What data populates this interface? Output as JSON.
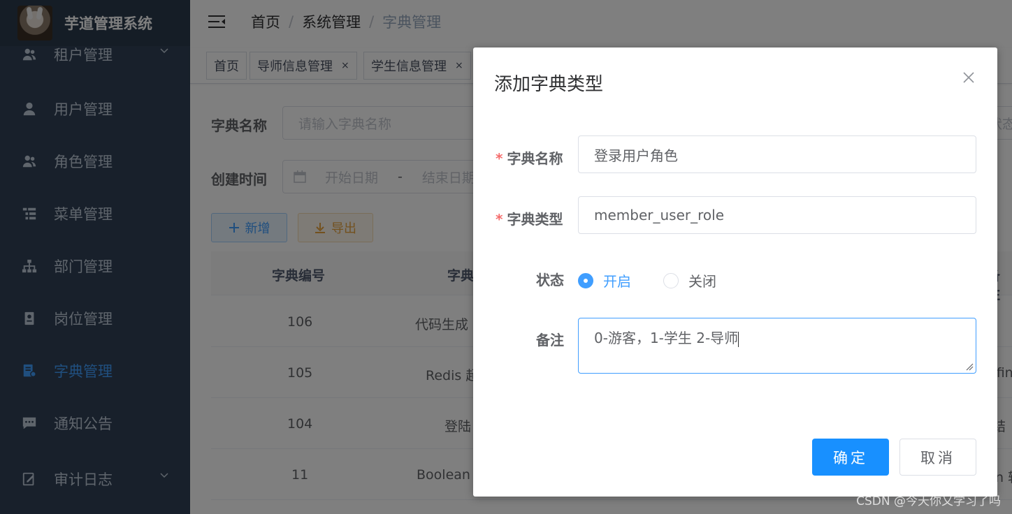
{
  "app": {
    "title": "芋道管理系统"
  },
  "sidebar": {
    "items": [
      {
        "label": "租户管理",
        "icon": "peoples-icon",
        "expandable": true
      },
      {
        "label": "用户管理",
        "icon": "user-icon"
      },
      {
        "label": "角色管理",
        "icon": "peoples-icon"
      },
      {
        "label": "菜单管理",
        "icon": "tree-table-icon"
      },
      {
        "label": "部门管理",
        "icon": "tree-icon"
      },
      {
        "label": "岗位管理",
        "icon": "post-icon"
      },
      {
        "label": "字典管理",
        "icon": "dict-icon",
        "active": true
      },
      {
        "label": "通知公告",
        "icon": "message-icon"
      },
      {
        "label": "审计日志",
        "icon": "log-icon",
        "expandable": true
      }
    ]
  },
  "breadcrumb": {
    "items": [
      "首页",
      "系统管理",
      "字典管理"
    ]
  },
  "tags": [
    {
      "label": "首页"
    },
    {
      "label": "导师信息管理",
      "close": "×"
    },
    {
      "label": "学生信息管理",
      "close": "×"
    }
  ],
  "search": {
    "name_label": "字典名称",
    "name_placeholder": "请输入字典名称",
    "time_label": "创建时间",
    "start_placeholder": "开始日期",
    "range_sep": "-",
    "end_placeholder": "结束日期",
    "status_placeholder": "状态"
  },
  "toolbar": {
    "add_label": "新增",
    "export_label": "导出"
  },
  "table": {
    "headers": [
      "字典编号",
      "字典",
      "备注"
    ],
    "rows": [
      {
        "id": "106",
        "name": "代码生成",
        "remark": ""
      },
      {
        "id": "105",
        "name": "Redis 超",
        "remark": "efin"
      },
      {
        "id": "104",
        "name": "登陆",
        "remark": "结"
      },
      {
        "id": "11",
        "name": "Boolean",
        "remark": "n 转"
      }
    ]
  },
  "dialog": {
    "title": "添加字典类型",
    "fields": {
      "name_label": "字典名称",
      "name_value": "登录用户角色",
      "type_label": "字典类型",
      "type_value": "member_user_role",
      "status_label": "状态",
      "status_options": [
        "开启",
        "关闭"
      ],
      "status_selected": "开启",
      "remark_label": "备注",
      "remark_value": "0-游客，1-学生 2-导师"
    },
    "required_mark": "*",
    "ok_label": "确定",
    "cancel_label": "取消"
  },
  "watermark": "CSDN @今天你又学习了吗",
  "colors": {
    "primary": "#409eff",
    "sidebar_bg": "#304156",
    "danger": "#f56c6c",
    "warning": "#e6a23c"
  }
}
